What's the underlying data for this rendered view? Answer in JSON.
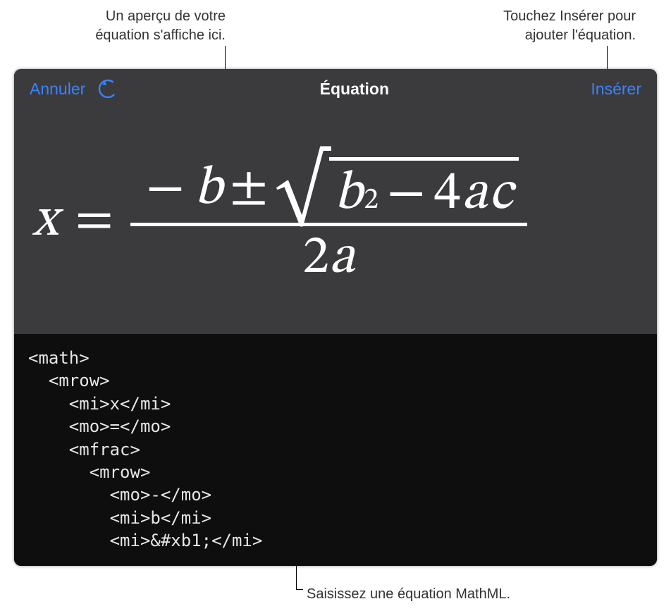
{
  "callouts": {
    "preview": "Un aperçu de votre\néquation s'affiche ici.",
    "insert": "Touchez Insérer pour\najouter l'équation.",
    "input": "Saisissez une équation MathML."
  },
  "titlebar": {
    "cancel": "Annuler",
    "title": "Équation",
    "insert": "Insérer",
    "undo_icon_name": "undo-icon"
  },
  "equation_display": {
    "x": "x",
    "equals": "=",
    "minus": "−",
    "b": "b",
    "plusminus": "±",
    "sqrt": "√",
    "b2": "b",
    "exp2": "2",
    "minus2": "−",
    "four": "4",
    "a": "a",
    "c": "c",
    "two": "2",
    "a2": "a"
  },
  "mathml_source": "<math>\n  <mrow>\n    <mi>x</mi>\n    <mo>=</mo>\n    <mfrac>\n      <mrow>\n        <mo>-</mo>\n        <mi>b</mi>\n        <mi>&#xb1;</mi>"
}
